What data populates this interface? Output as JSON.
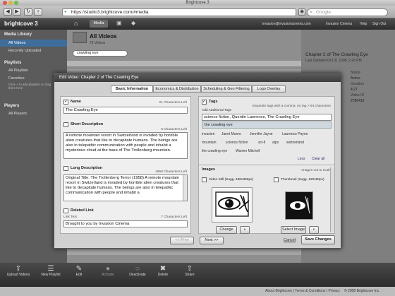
{
  "browser": {
    "title": "Brightcove 3",
    "url": "https://studio3.brightcove.com/#media",
    "search_placeholder": "Google"
  },
  "app": {
    "logo": "brightcove 3",
    "nav_home": "Home",
    "nav_media": "Media",
    "user_email": "invasion@invasioncinema.com",
    "user_name": "Invasion Cinema",
    "help": "Help",
    "sign_out": "Sign Out"
  },
  "sidebar": {
    "media_library": "Media Library",
    "all_videos": "All Videos",
    "recently_uploaded": "Recently Uploaded",
    "playlists": "Playlists",
    "all_playlists": "All Playlists",
    "favorites": "Favorites",
    "favorites_hint": "Click + to add playlists or drag them here",
    "players": "Players",
    "all_players": "All Players"
  },
  "main": {
    "title": "All Videos",
    "subtitle": "72 Videos",
    "search_value": "crawling eye"
  },
  "right_panel": {
    "title": "Chapter 2 of The Crawling Eye",
    "updated": "Last Updated Oct 31 2008, 2:43 PM",
    "status_label": "Status",
    "status_value": "Active",
    "duration_label": "Duration",
    "duration_value": "4:27",
    "video_id_label": "Video ID",
    "video_id_value": "2780419"
  },
  "bottom": {
    "upload": "Upload Videos",
    "new_playlist": "New Playlist",
    "edit": "Edit",
    "activate": "Activate",
    "deactivate": "Deactivate",
    "delete": "Delete",
    "share": "Share"
  },
  "status": {
    "left": "",
    "links": "About Brightcove | Terms & Conditions | Privacy",
    "copyright": "© 2008 Brightcove Inc."
  },
  "modal": {
    "title": "Edit Video: Chapter 2 of The Crawling Eye",
    "tabs": [
      "Basic Information",
      "Economics & Distribution",
      "Scheduling & Geo Filtering",
      "Logo Overlay"
    ],
    "name_label": "Name",
    "name_hint": "21 Characters Left",
    "name_value": "The Crawling Eye",
    "short_desc_label": "Short Description",
    "short_desc_hint": "6 Characters Left",
    "short_desc_value": "A remote mountain resort in Switzerland is invaded by horrible alien creatures that like to decapitate humans. The beings are also in telepathic communication with people and inhabit a mysterious cloud at the base of The Trollenberg mountain.",
    "long_desc_label": "Long Description",
    "long_desc_hint": "4658 Characters Left",
    "long_desc_value": "Original Title: The Trollenberg Terror (1958) A remote mountain resort in Switzerland is invaded by horrible alien creatures that like to decapitate humans. The beings are also in telepathic communication with people and inhabit a",
    "related_link_label": "Related Link",
    "link_text_label": "Link Text",
    "link_text_hint": "7 Characters Left",
    "link_text_value": "Brought to you by Invasion Cinema",
    "tags_label": "Tags",
    "tags_hint": "Separate tags with a comma; no tag > 64 characters",
    "add_tag_label": "Add Additional Tags",
    "add_tag_value": "science fiction, Quentin Lawrence, The Crawling Eye",
    "tag_suggest": "the crawling eye",
    "tags": [
      "invasion",
      "Janet Munro",
      "Jennifer Jayne",
      "Laurence Payne",
      "mountain",
      "science fiction",
      "sci-fi",
      "alps",
      "switzerland",
      "the crawling eye",
      "Warren Mitchell"
    ],
    "less_link": "Less",
    "clear_all": "Clear all",
    "images_label": "Images",
    "images_hint": "Images not to scale",
    "video_still": "Video Still (Sugg. 480x360px)",
    "thumbnail": "Thumbnail (Sugg. 120x90px)",
    "change_btn": "Change",
    "select_image_btn": "Select Image",
    "prev_btn": "<< Prev",
    "next_btn": "Next >>",
    "cancel": "Cancel",
    "save": "Save Changes"
  }
}
